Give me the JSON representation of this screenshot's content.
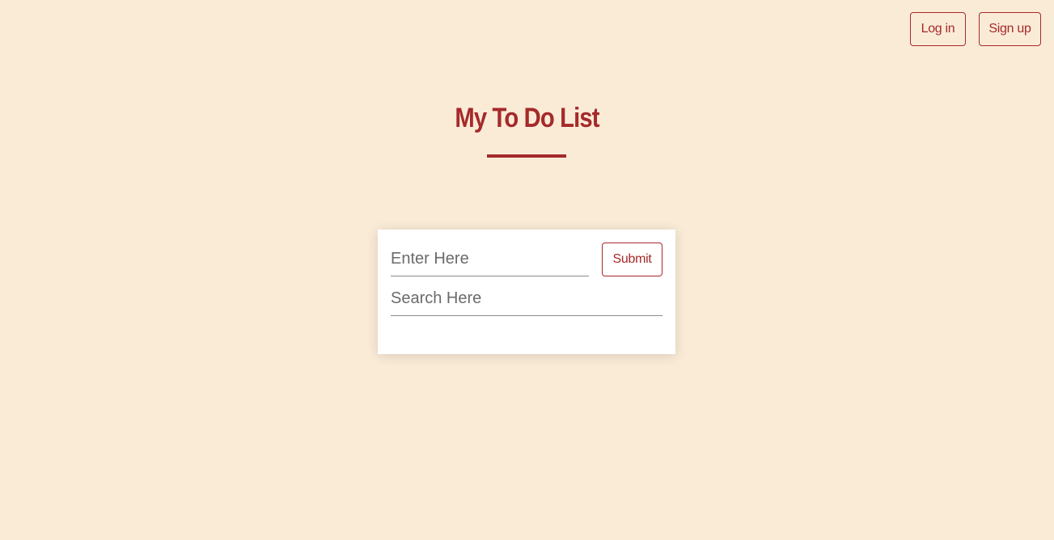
{
  "header": {
    "login_label": "Log in",
    "signup_label": "Sign up"
  },
  "main": {
    "title": "My To Do List"
  },
  "todo_form": {
    "enter_placeholder": "Enter Here",
    "enter_value": "",
    "submit_label": "Submit",
    "search_placeholder": "Search Here",
    "search_value": ""
  },
  "colors": {
    "background": "#faebd7",
    "accent": "#a52a2a",
    "card": "#ffffff"
  }
}
